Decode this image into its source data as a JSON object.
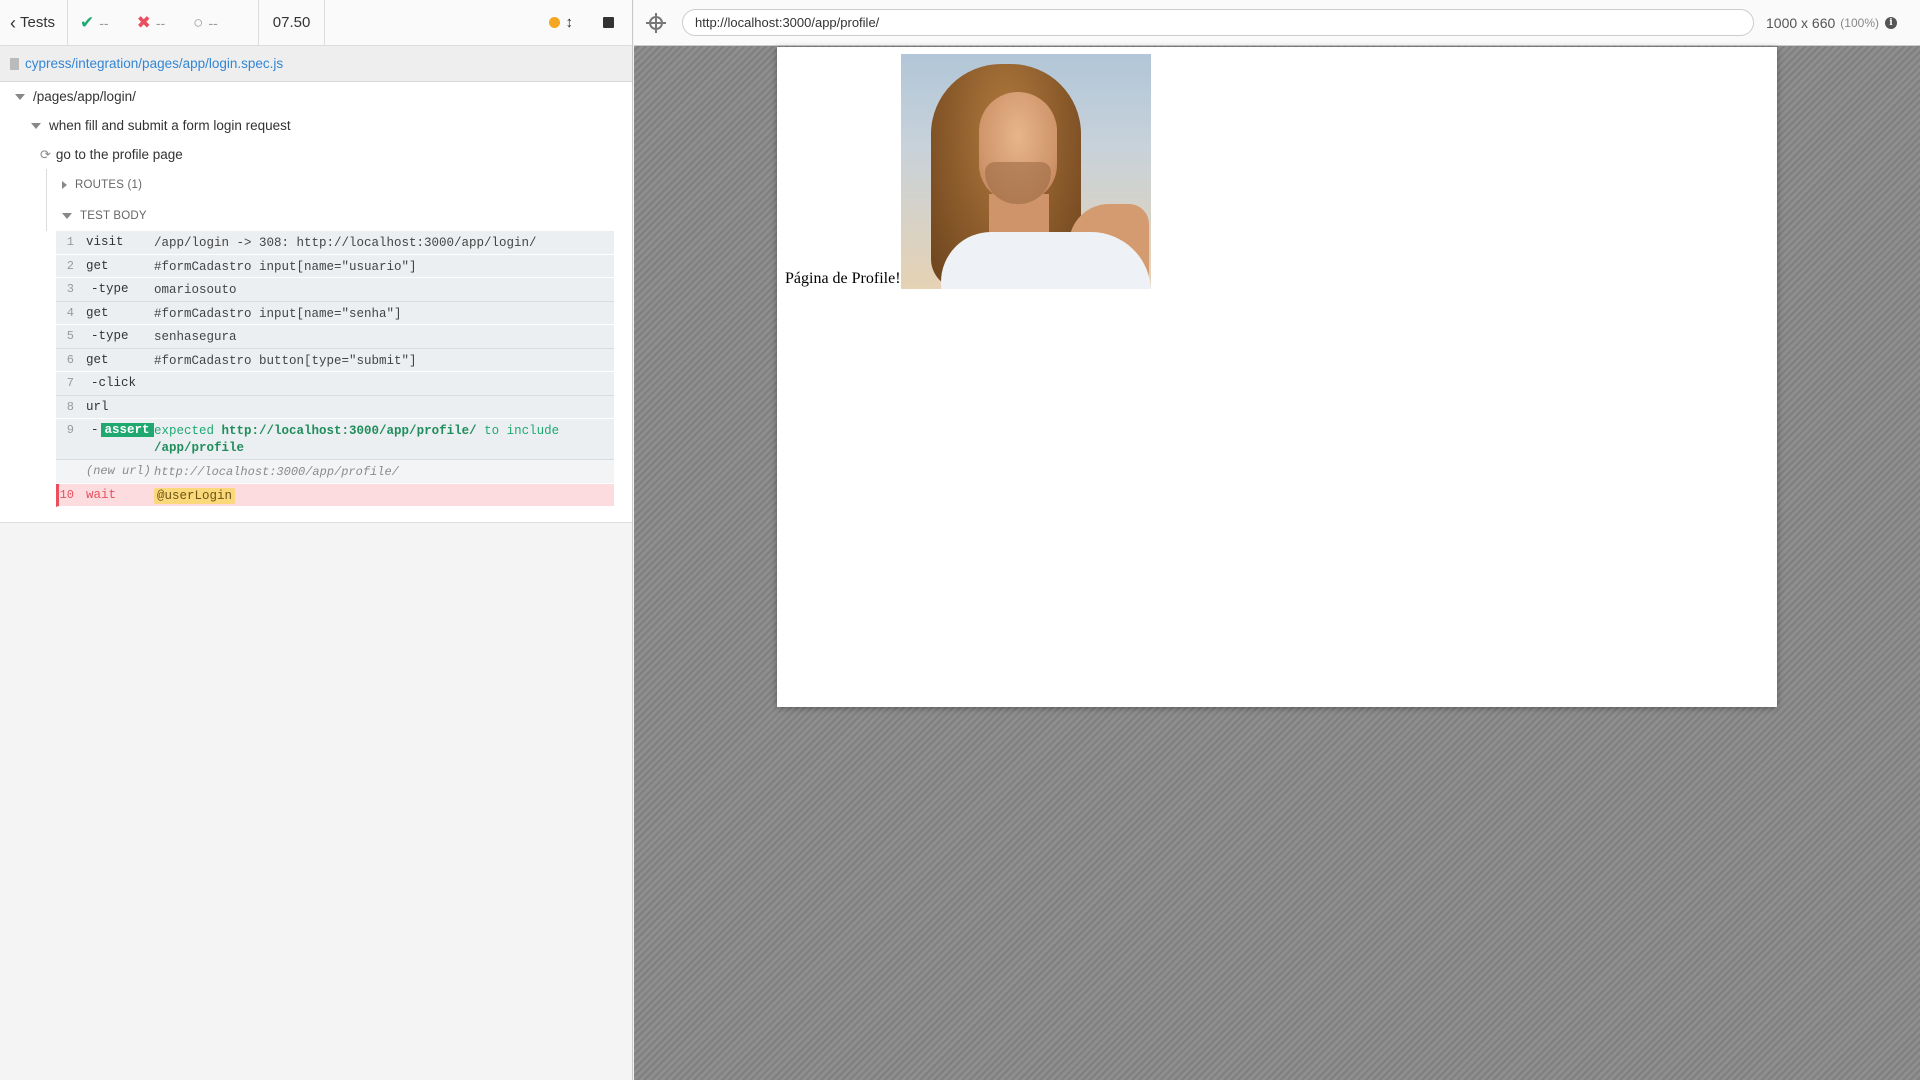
{
  "reporter": {
    "back_label": "Tests",
    "passed": "--",
    "failed": "--",
    "pending": "--",
    "duration": "07.50",
    "spec_path": "cypress/integration/pages/app/login.spec.js",
    "suite": "/pages/app/login/",
    "describe": "when fill and submit a form login request",
    "test_title": "go to the profile page",
    "routes_label": "ROUTES (1)",
    "test_body_label": "TEST BODY",
    "commands": [
      {
        "num": "1",
        "name": "visit",
        "msg": "/app/login -> 308: http://localhost:3000/app/login/"
      },
      {
        "num": "2",
        "name": "get",
        "msg": "#formCadastro input[name=\"usuario\"]"
      },
      {
        "num": "3",
        "name": "-type",
        "msg": "omariosouto"
      },
      {
        "num": "4",
        "name": "get",
        "msg": "#formCadastro input[name=\"senha\"]"
      },
      {
        "num": "5",
        "name": "-type",
        "msg": "senhasegura"
      },
      {
        "num": "6",
        "name": "get",
        "msg": "#formCadastro button[type=\"submit\"]"
      },
      {
        "num": "7",
        "name": "-click",
        "msg": ""
      },
      {
        "num": "8",
        "name": "url",
        "msg": ""
      },
      {
        "num": "9",
        "name": "-",
        "badge": "assert",
        "msg_prefix": "expected",
        "msg_url": "http://localhost:3000/app/profile/",
        "msg_mid": "to include",
        "msg_value": "/app/profile"
      },
      {
        "num": "",
        "name": "(new url)",
        "msg": "http://localhost:3000/app/profile/"
      },
      {
        "num": "10",
        "name": "wait",
        "msg": "@userLogin"
      }
    ]
  },
  "aut": {
    "url": "http://localhost:3000/app/profile/",
    "viewport": "1000 x 660",
    "zoom": "(100%)",
    "page_text": "Página de Profile!"
  },
  "colors": {
    "pass": "#1fa971",
    "fail": "#e94f5f",
    "link": "#3386d4",
    "running": "#f5a623"
  },
  "icons": [
    "chevron-left-icon",
    "check-icon",
    "x-icon",
    "circle-icon",
    "dot-icon",
    "arrows-icon",
    "stop-icon",
    "file-icon",
    "spinner-icon",
    "crosshair-icon",
    "info-icon"
  ]
}
